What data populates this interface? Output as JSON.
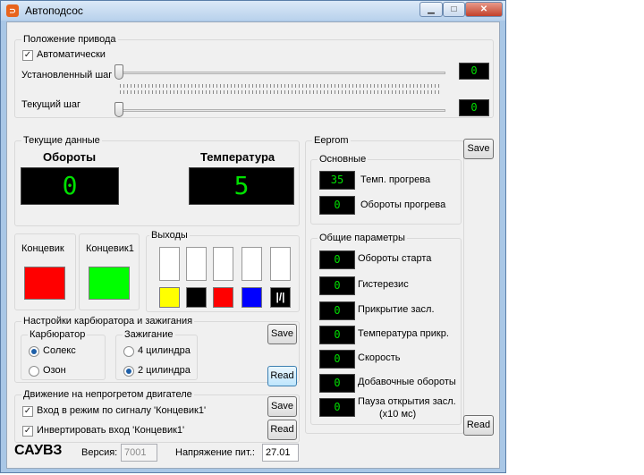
{
  "window": {
    "title": "Автоподсос",
    "controls": [
      "minimize-icon",
      "maximize-icon",
      "close-icon"
    ]
  },
  "drive": {
    "title": "Положение привода",
    "auto_label": "Автоматически",
    "auto_checked": true,
    "set_step_label": "Установленный шаг",
    "set_step_value": "0",
    "cur_step_label": "Текущий шаг",
    "cur_step_value": "0"
  },
  "current": {
    "title": "Текущие данные",
    "rpm_label": "Обороты",
    "rpm_value": "0",
    "temp_label": "Температура",
    "temp_value": "5"
  },
  "limits": {
    "k1_label": "Концевик",
    "k1_color": "#ff0000",
    "k2_label": "Концевик1",
    "k2_color": "#00ff00"
  },
  "outputs": {
    "title": "Выходы",
    "colors": [
      "#ffff00",
      "#000000",
      "#ff0000",
      "#0000ff",
      "#000000"
    ],
    "last_symbol": "|/|"
  },
  "carb": {
    "title": "Настройки карбюратора и зажигания",
    "carb_group": "Карбюратор",
    "opt1": "Солекс",
    "opt2": "Озон",
    "ign_group": "Зажигание",
    "ign1": "4 цилиндра",
    "ign2": "2 цилиндра",
    "save": "Save",
    "read": "Read"
  },
  "cold": {
    "title": "Движение на непрогретом двигателе",
    "opt1": "Вход в режим по сигналу 'Концевик1'",
    "opt2": "Инвертировать вход 'Концевик1'",
    "save": "Save",
    "read": "Read"
  },
  "eeprom": {
    "title": "Eeprom",
    "save": "Save",
    "read": "Read",
    "main_title": "Основные",
    "main_items": [
      {
        "value": "35",
        "label": "Темп. прогрева"
      },
      {
        "value": "0",
        "label": "Обороты прогрева"
      }
    ],
    "common_title": "Общие параметры",
    "common_items": [
      {
        "value": "0",
        "label": "Обороты старта"
      },
      {
        "value": "0",
        "label": "Гистерезис"
      },
      {
        "value": "0",
        "label": "Прикрытие засл."
      },
      {
        "value": "0",
        "label": "Температура прикр."
      },
      {
        "value": "0",
        "label": "Скорость"
      },
      {
        "value": "0",
        "label": "Добавочные обороты"
      },
      {
        "value": "0",
        "label": "Пауза открытия засл."
      }
    ],
    "pause_unit": "(х10 мс)"
  },
  "footer": {
    "brand": "САУВЗ",
    "version_label": "Версия:",
    "version_value": "7001",
    "voltage_label": "Напряжение пит.:",
    "voltage_value": "27.01"
  }
}
